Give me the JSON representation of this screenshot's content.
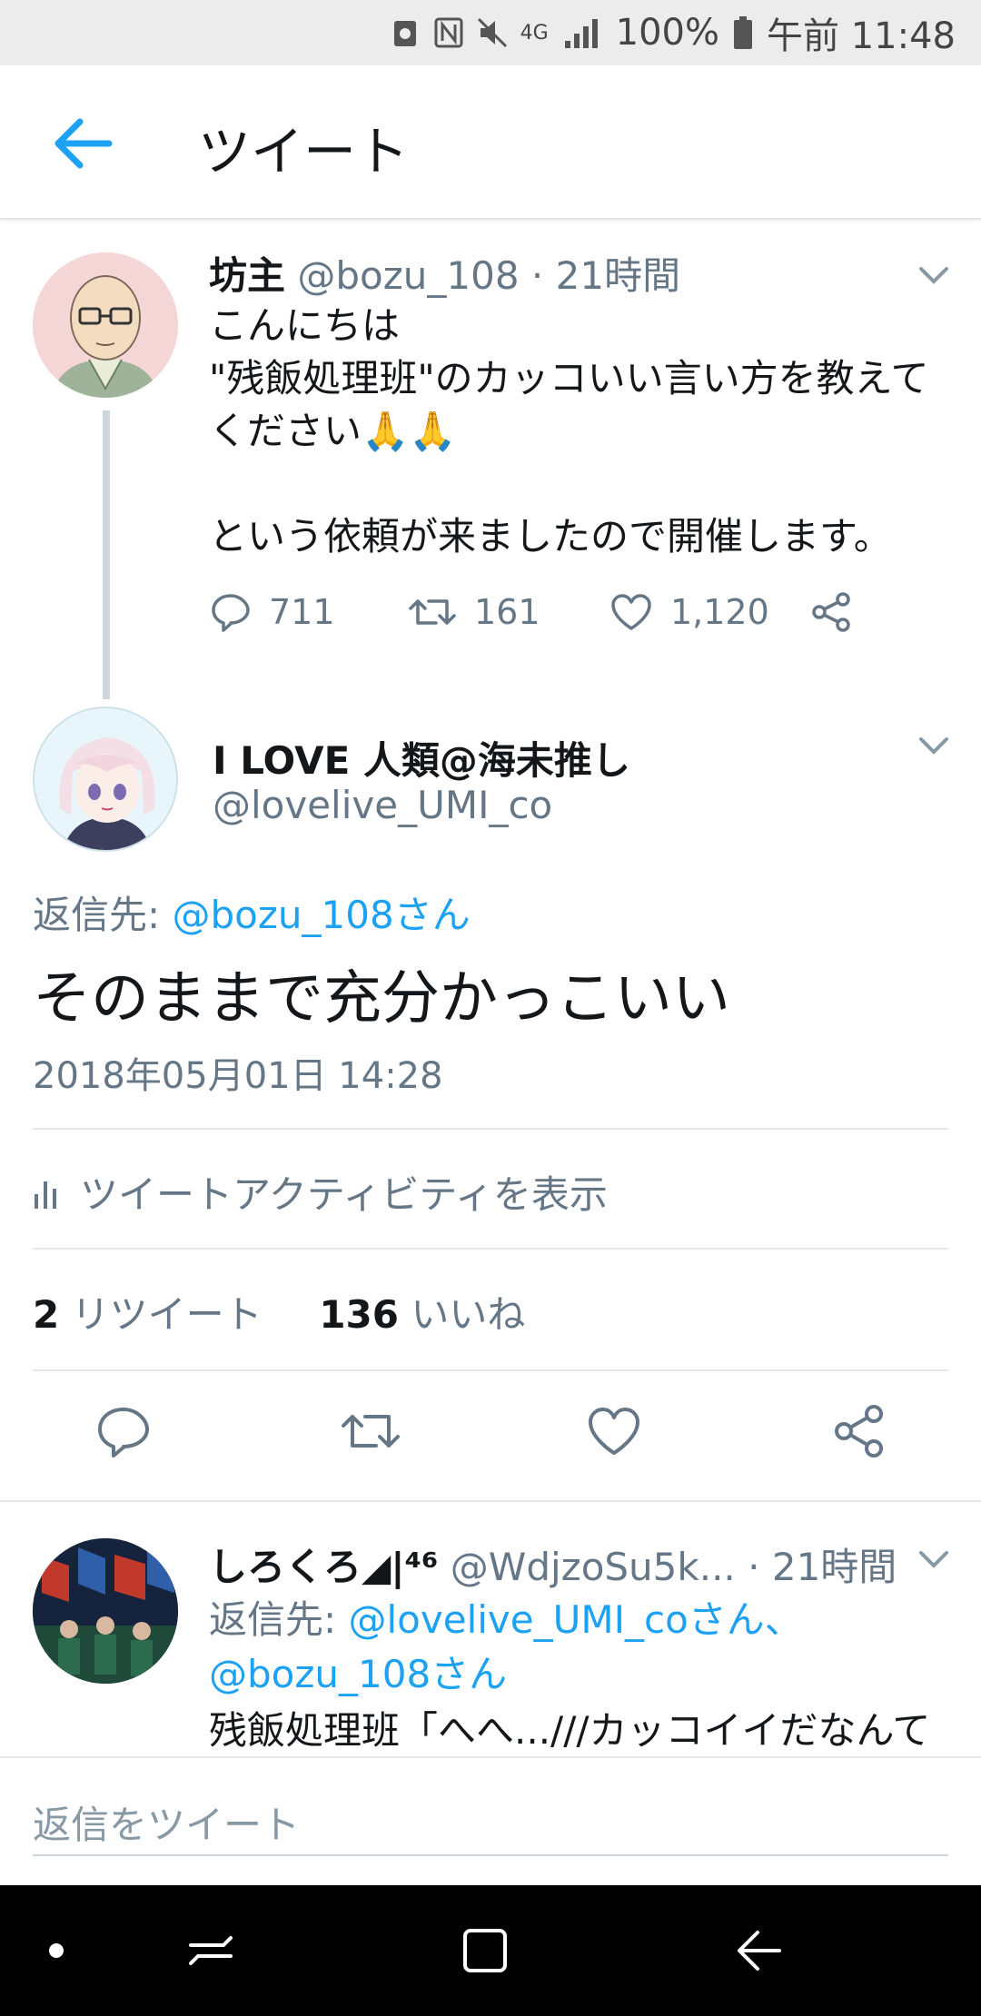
{
  "status_bar": {
    "battery": "100%",
    "network": "4G",
    "time": "午前 11:48"
  },
  "header": {
    "title": "ツイート"
  },
  "tweet_parent": {
    "display_name": "坊主",
    "handle": "@bozu_108",
    "time_ago": "· 21時間",
    "body_lines": [
      "こんにちは",
      "\"残飯処理班\"のカッコいい言い方を教えて",
      "ください🙏🙏",
      "",
      "という依頼が来ましたので開催します。"
    ],
    "replies": "711",
    "retweets": "161",
    "likes": "1,120"
  },
  "tweet_main": {
    "display_name": "I LOVE 人類@海未推し",
    "handle": "@lovelive_UMI_co",
    "reply_label": "返信先: ",
    "reply_target": "@bozu_108さん",
    "text": "そのままで充分かっこいい",
    "timestamp": "2018年05月01日 14:28",
    "activity_label": "ツイートアクティビティを表示",
    "retweet_count": "2",
    "retweet_label": "リツイート",
    "like_count": "136",
    "like_label": "いいね"
  },
  "tweet_reply": {
    "display_name": "しろくろ◢|⁴⁶",
    "handle": "@WdjzoSu5k...",
    "time_ago": "· 21時間",
    "reply_label": "返信先: ",
    "reply_target_1": "@lovelive_UMI_coさん、",
    "reply_target_2": "@bozu_108さん",
    "text": "残飯処理班「へへ...///カッコイイだなんて"
  },
  "compose": {
    "placeholder": "返信をツイート"
  },
  "colors": {
    "accent": "#1da1f2",
    "secondary_text": "#657786",
    "primary_text": "#14171a",
    "divider": "#e1e8ed"
  },
  "icons": [
    "back-arrow-icon",
    "reply-icon",
    "retweet-icon",
    "like-icon",
    "share-icon",
    "chevron-down-icon",
    "bar-chart-icon"
  ]
}
